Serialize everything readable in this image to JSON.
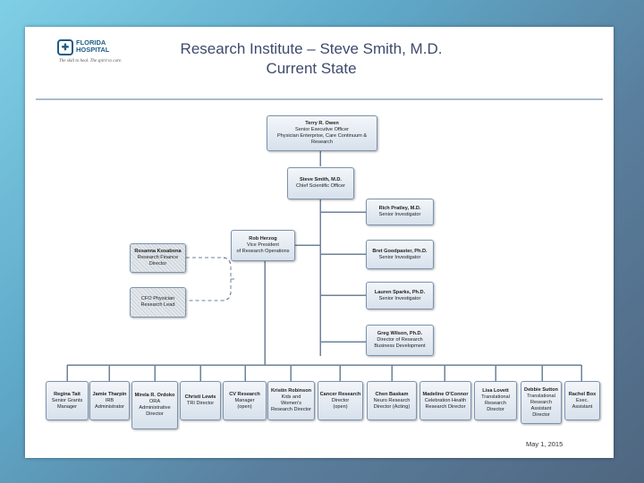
{
  "logo": {
    "name": "FLORIDA\nHOSPITAL",
    "tagline": "The skill to heal. The spirit to care."
  },
  "title": {
    "line1": "Research Institute – Steve Smith, M.D.",
    "line2": "Current State"
  },
  "nodes": {
    "owen": {
      "name": "Terry R. Owen",
      "title": "Senior Executive Officer\nPhysician Enterprise, Care Continuum &\nResearch"
    },
    "smith": {
      "name": "Steve Smith, M.D.",
      "title": "Chief Scientific Officer"
    },
    "pratley": {
      "name": "Rich Pratley, M.D.",
      "title": "Senior Investigator"
    },
    "goodpaster": {
      "name": "Bret Goodpaster, Ph.D.",
      "title": "Senior Investigator"
    },
    "herzog": {
      "name": "Rob Herzog",
      "title": "Vice President\nof Research Operations"
    },
    "kosabona": {
      "name": "Rosanna Kosabona",
      "title": "Research Finance\nDirector"
    },
    "cfo": {
      "name": "",
      "title": "CFO Physician\nResearch Lead"
    },
    "sparks": {
      "name": "Lauren Sparks, Ph.D.",
      "title": "Senior Investigator"
    },
    "wilson": {
      "name": "Greg Wilson, Ph.D.",
      "title": "Director of Research\nBusiness Development"
    }
  },
  "bottom_nodes": [
    {
      "name": "Regina Tait",
      "title": "Senior Grants\nManager"
    },
    {
      "name": "Jamie Tharpin",
      "title": "IRB\nAdministrator"
    },
    {
      "name": "Mirela R. Ordoko",
      "title": "ORA\nAdministrative\nDirector"
    },
    {
      "name": "Christi Lewis",
      "title": "TRI Director"
    },
    {
      "name": "CV Research",
      "title": "Manager\n(open)"
    },
    {
      "name": "Kristin Robinson",
      "title": "Kids and\nWomen's\nResearch Director"
    },
    {
      "name": "Cancer Research",
      "title": "Director\n(open)"
    },
    {
      "name": "Chen Baskam",
      "title": "Neuro Research\nDirector (Acting)"
    },
    {
      "name": "Madeline O'Connor",
      "title": "Celebration Health\nResearch Director"
    },
    {
      "name": "Lisa Lovett",
      "title": "Translational\nResearch\nDirector"
    },
    {
      "name": "Debbie Sutton",
      "title": "Translational\nResearch\nAssistant\nDirector"
    },
    {
      "name": "Rachel Box",
      "title": "Exec.\nAssistant"
    }
  ],
  "date": "May 1, 2015",
  "colors": {
    "title": "#3d4a6b",
    "box_border": "#7c93ad",
    "connector": "#6d8299",
    "slide_bg": "#ffffff"
  }
}
